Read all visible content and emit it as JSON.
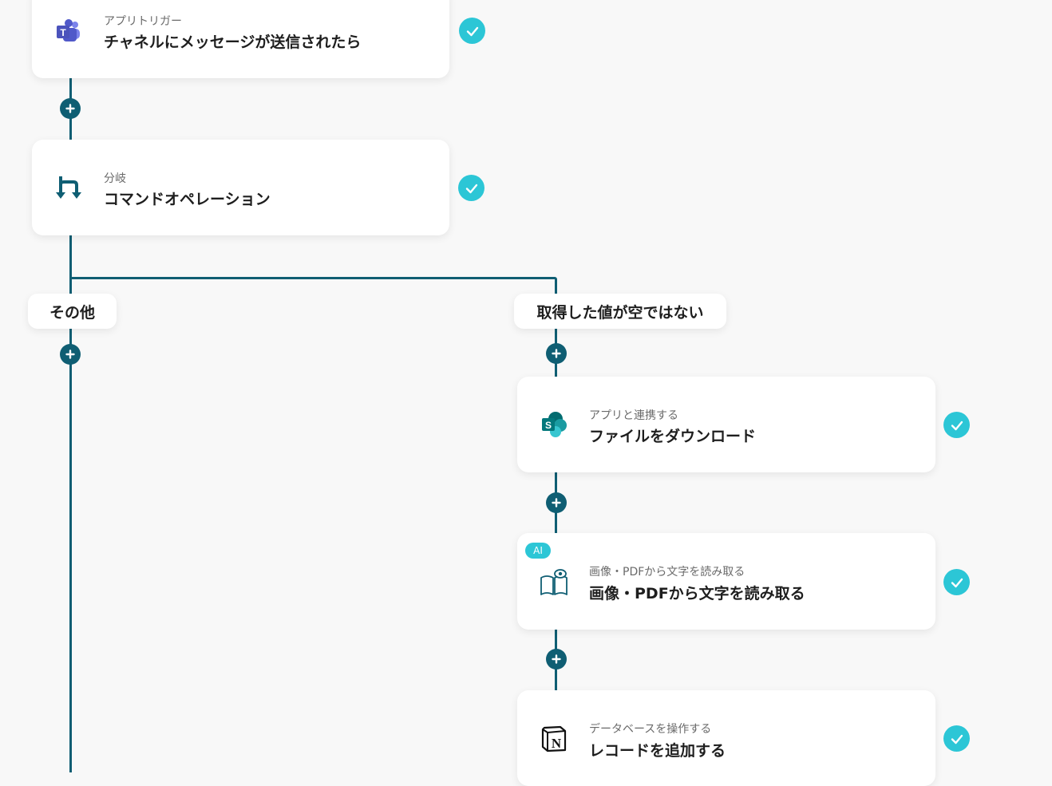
{
  "colors": {
    "line": "#0f5e73",
    "check": "#2cc6d6",
    "card_bg": "#ffffff",
    "canvas_bg": "#f8f8f8",
    "ai_badge": "#2cc6d6"
  },
  "nodes": [
    {
      "subtitle": "アプリトリガー",
      "title": "チャネルにメッセージが送信されたら",
      "icon": "microsoft-teams-icon",
      "status": "completed"
    },
    {
      "subtitle": "分岐",
      "title": "コマンドオペレーション",
      "icon": "branch-icon",
      "status": "completed"
    },
    {
      "subtitle": "アプリと連携する",
      "title": "ファイルをダウンロード",
      "icon": "sharepoint-icon",
      "status": "completed"
    },
    {
      "subtitle": "画像・PDFから文字を読み取る",
      "title": "画像・PDFから文字を読み取る",
      "icon": "book-eye-icon",
      "status": "completed",
      "badge": "AI"
    },
    {
      "subtitle": "データベースを操作する",
      "title": "レコードを追加する",
      "icon": "notion-icon",
      "status": "completed"
    }
  ],
  "branches": [
    {
      "label": "その他"
    },
    {
      "label": "取得した値が空ではない"
    }
  ]
}
